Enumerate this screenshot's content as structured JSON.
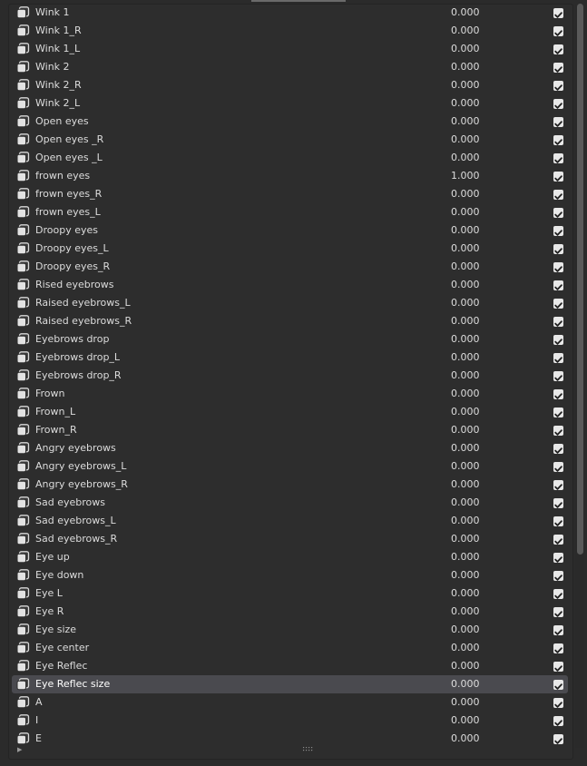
{
  "rows": [
    {
      "name": "Wink 1",
      "value": "0.000"
    },
    {
      "name": "Wink 1_R",
      "value": "0.000"
    },
    {
      "name": "Wink 1_L",
      "value": "0.000"
    },
    {
      "name": "Wink 2",
      "value": "0.000"
    },
    {
      "name": "Wink 2_R",
      "value": "0.000"
    },
    {
      "name": "Wink 2_L",
      "value": "0.000"
    },
    {
      "name": "Open eyes",
      "value": "0.000"
    },
    {
      "name": "Open eyes _R",
      "value": "0.000"
    },
    {
      "name": "Open eyes _L",
      "value": "0.000"
    },
    {
      "name": "frown eyes",
      "value": "1.000"
    },
    {
      "name": "frown eyes_R",
      "value": "0.000"
    },
    {
      "name": "frown eyes_L",
      "value": "0.000"
    },
    {
      "name": "Droopy eyes",
      "value": "0.000"
    },
    {
      "name": "Droopy eyes_L",
      "value": "0.000"
    },
    {
      "name": "Droopy eyes_R",
      "value": "0.000"
    },
    {
      "name": "Rised eyebrows",
      "value": "0.000"
    },
    {
      "name": "Raised eyebrows_L",
      "value": "0.000"
    },
    {
      "name": "Raised eyebrows_R",
      "value": "0.000"
    },
    {
      "name": "Eyebrows drop",
      "value": "0.000"
    },
    {
      "name": "Eyebrows drop_L",
      "value": "0.000"
    },
    {
      "name": "Eyebrows drop_R",
      "value": "0.000"
    },
    {
      "name": "Frown",
      "value": "0.000"
    },
    {
      "name": "Frown_L",
      "value": "0.000"
    },
    {
      "name": "Frown_R",
      "value": "0.000"
    },
    {
      "name": "Angry eyebrows",
      "value": "0.000"
    },
    {
      "name": "Angry eyebrows_L",
      "value": "0.000"
    },
    {
      "name": "Angry eyebrows_R",
      "value": "0.000"
    },
    {
      "name": "Sad eyebrows",
      "value": "0.000"
    },
    {
      "name": "Sad eyebrows_L",
      "value": "0.000"
    },
    {
      "name": "Sad eyebrows_R",
      "value": "0.000"
    },
    {
      "name": "Eye up",
      "value": "0.000"
    },
    {
      "name": "Eye down",
      "value": "0.000"
    },
    {
      "name": "Eye L",
      "value": "0.000"
    },
    {
      "name": "Eye R",
      "value": "0.000"
    },
    {
      "name": "Eye size",
      "value": "0.000"
    },
    {
      "name": "Eye center",
      "value": "0.000"
    },
    {
      "name": "Eye Reflec",
      "value": "0.000"
    },
    {
      "name": "Eye Reflec size",
      "value": "0.000",
      "selected": true
    },
    {
      "name": "A",
      "value": "0.000"
    },
    {
      "name": "I",
      "value": "0.000"
    },
    {
      "name": "E",
      "value": "0.000"
    }
  ],
  "row_icon": "shape-key-icon",
  "checkbox_state": "checked",
  "selected_color": "#4a4a4f",
  "background_color": "#2b2b2b"
}
